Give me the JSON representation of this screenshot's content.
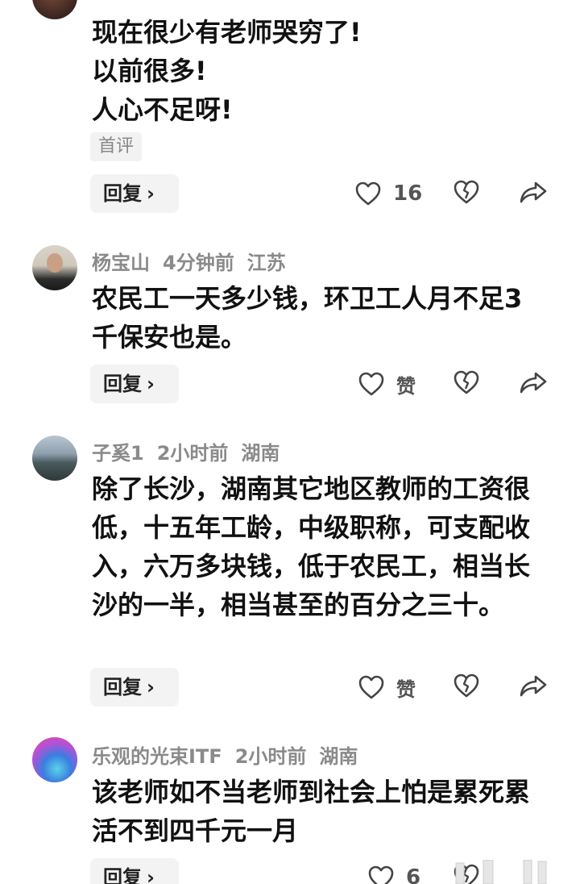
{
  "comments": [
    {
      "text": "现在很少有老师哭穷了!\n以前很多!\n人心不足呀!",
      "tag": "首评",
      "reply_label": "回复",
      "like_label": "16"
    },
    {
      "username": "杨宝山",
      "time": "4分钟前",
      "location": "江苏",
      "text": "农民工一天多少钱，环卫工人月不足3千保安也是。",
      "reply_label": "回复",
      "like_label": "赞"
    },
    {
      "username": "子奚1",
      "time": "2小时前",
      "location": "湖南",
      "text": "除了长沙，湖南其它地区教师的工资很低，十五年工龄，中级职称，可支配收入，六万多块钱，低于农民工，相当长沙的一半，相当甚至的百分之三十。",
      "reply_label": "回复",
      "like_label": "赞"
    },
    {
      "username": "乐观的光束ITF",
      "time": "2小时前",
      "location": "湖南",
      "text": "该老师如不当老师到社会上怕是累死累活不到四千元一月",
      "reply_label": "回复",
      "like_label": "6"
    }
  ],
  "icons": {
    "like": "heart-outline-icon",
    "dislike": "broken-heart-icon",
    "share": "share-arrow-icon",
    "reply_chevron": "chevron-right-icon"
  },
  "colors": {
    "text": "#111111",
    "meta": "#8a8a8a",
    "button_bg": "#f3f3f3"
  }
}
